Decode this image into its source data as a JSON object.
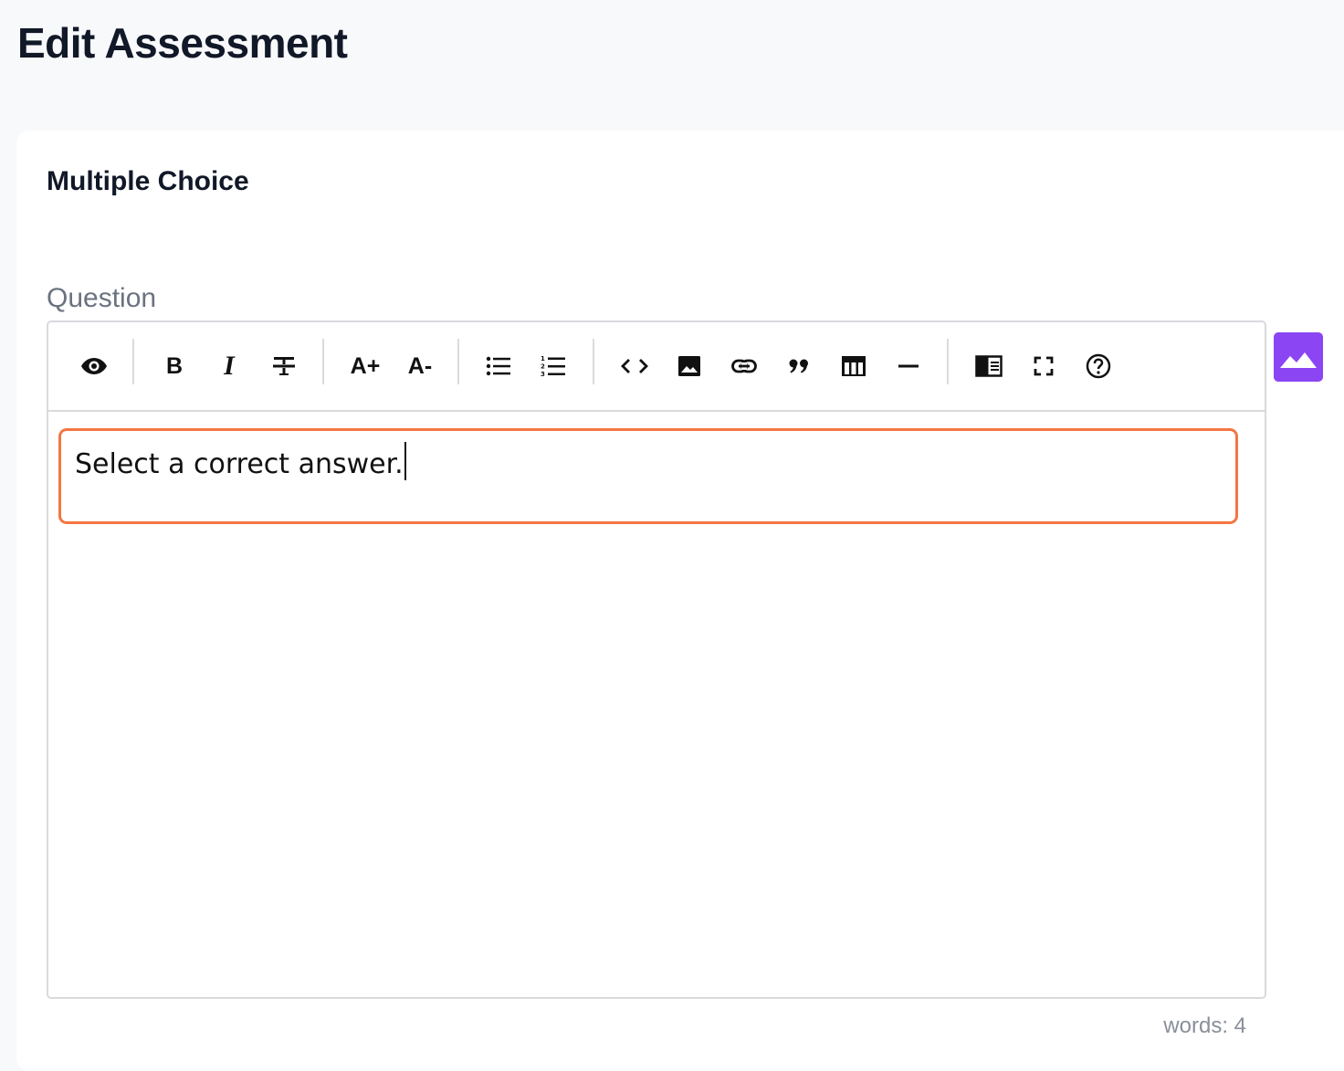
{
  "page": {
    "title": "Edit Assessment"
  },
  "card": {
    "section_title": "Multiple Choice",
    "question_label": "Question"
  },
  "editor": {
    "content": "Select a correct answer.",
    "word_count": "words: 4",
    "toolbar": {
      "bold_label": "B",
      "italic_label": "I",
      "font_increase_label": "A+",
      "font_decrease_label": "A-",
      "icons": [
        "preview-icon",
        "bold-icon",
        "italic-icon",
        "strikethrough-icon",
        "font-size-increase-icon",
        "font-size-decrease-icon",
        "unordered-list-icon",
        "ordered-list-icon",
        "code-icon",
        "image-icon",
        "link-icon",
        "quote-icon",
        "table-icon",
        "horizontal-rule-icon",
        "side-by-side-icon",
        "fullscreen-icon",
        "help-icon"
      ]
    }
  },
  "image_upload": {
    "icon": "image-icon"
  },
  "colors": {
    "accent_orange": "#f47642",
    "image_button_purple": "#8c45f3",
    "page_background": "#f8f9fb"
  }
}
